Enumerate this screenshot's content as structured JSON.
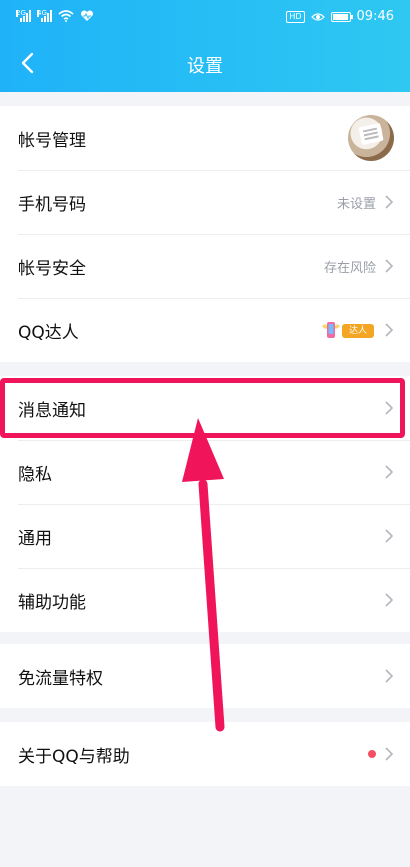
{
  "status_bar": {
    "time": "09:46",
    "hd": "HD",
    "sim1": "2G",
    "sim2": "4G"
  },
  "header": {
    "title": "设置"
  },
  "groups": [
    {
      "items": [
        {
          "label": "帐号管理"
        },
        {
          "label": "手机号码",
          "value": "未设置"
        },
        {
          "label": "帐号安全",
          "value": "存在风险"
        },
        {
          "label": "QQ达人",
          "badge_text": "达人"
        }
      ]
    },
    {
      "items": [
        {
          "label": "消息通知"
        },
        {
          "label": "隐私"
        },
        {
          "label": "通用"
        },
        {
          "label": "辅助功能"
        }
      ]
    },
    {
      "items": [
        {
          "label": "免流量特权"
        }
      ]
    },
    {
      "items": [
        {
          "label": "关于QQ与帮助"
        }
      ]
    }
  ],
  "colors": {
    "header_start": "#1fb2f8",
    "header_end": "#2ec8f2",
    "highlight": "#f0145a",
    "red_dot": "#f24f62",
    "value_text": "#9a9ea7"
  }
}
